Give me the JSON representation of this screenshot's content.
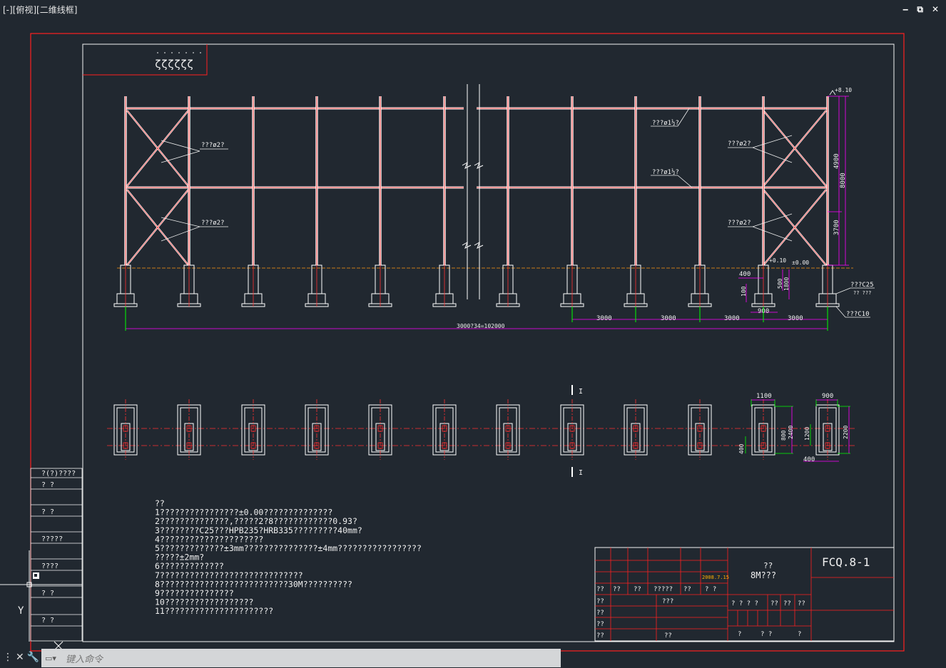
{
  "viewport": {
    "label": "[-][俯视][二维线框]"
  },
  "window_controls": [
    "‒",
    "⧉",
    "✕"
  ],
  "frame": {
    "corner_symbols": "ζζζζζζ"
  },
  "elevation": {
    "callouts": {
      "brace_left_top": "???ø2?",
      "brace_left_bot": "???ø2?",
      "brace_right_top": "???ø2?",
      "brace_right_bot": "???ø2?",
      "beam_top": "???ø1½?",
      "beam_mid": "???ø1½?",
      "conc_c25": "???C25",
      "conc_sub": "?? ???",
      "conc_c10": "???C10"
    },
    "elev_top": "+8.10",
    "elev_gnd1": "+0.10",
    "elev_gnd2": "±0.00",
    "dims": {
      "h4900": "4900",
      "h8000": "8000",
      "h3700": "3700",
      "d400": "400",
      "d500": "500",
      "d1800": "1800",
      "d100": "100",
      "d900": "900",
      "s1": "3000",
      "s2": "3000",
      "s3": "3000",
      "s4": "3000",
      "total": "3000?34=102000"
    }
  },
  "plan": {
    "section_mark_top": "I",
    "section_mark_bot": "I",
    "dims": {
      "w1100": "1100",
      "w900": "900",
      "h800": "800",
      "h2400": "2400",
      "h1200": "1200",
      "h2200": "2200",
      "d400a": "400",
      "d400b": "400"
    }
  },
  "notes": [
    "??",
    "1????????????????±0.00??????????????",
    "2??????????????,?????2?8????????????0.93?",
    "3????????C25???HPB235?HRB335?????????40mm?",
    "4?????????????????????",
    "5?????????????±3mm???????????????±4mm?????????????????",
    "?????±2mm?",
    "6?????????????",
    "7?????????????????????????????",
    "8??????????????????????????30M??????????",
    "9???????????????",
    "10??????????????????",
    "11??????????????????????"
  ],
  "left_panel": [
    "?(?)????",
    "?  ?",
    "?  ?",
    "?????",
    "????",
    "?  ?",
    "?  ?"
  ],
  "title_block": {
    "date": "2008.7.15",
    "project_line1": "??",
    "project_line2": "8M???",
    "drawing_no": "FCQ.8-1",
    "row_labels": [
      "??",
      "??",
      "??",
      "?????",
      "??",
      "? ?"
    ],
    "col_labels": [
      "??",
      "??",
      "??",
      "??"
    ],
    "mid_labels": [
      "???",
      "??"
    ],
    "right_row1": [
      "? ? ? ?",
      "??",
      "??",
      "??"
    ],
    "right_row2": [
      "?",
      "? ?",
      "?"
    ]
  },
  "ucs": {
    "y": "Y"
  },
  "command": {
    "placeholder": "键入命令"
  },
  "colors": {
    "bg": "#212830",
    "frame_red": "#ff2020",
    "white": "#ffffff",
    "magenta": "#ff00ff",
    "orange": "#c87a1a"
  }
}
